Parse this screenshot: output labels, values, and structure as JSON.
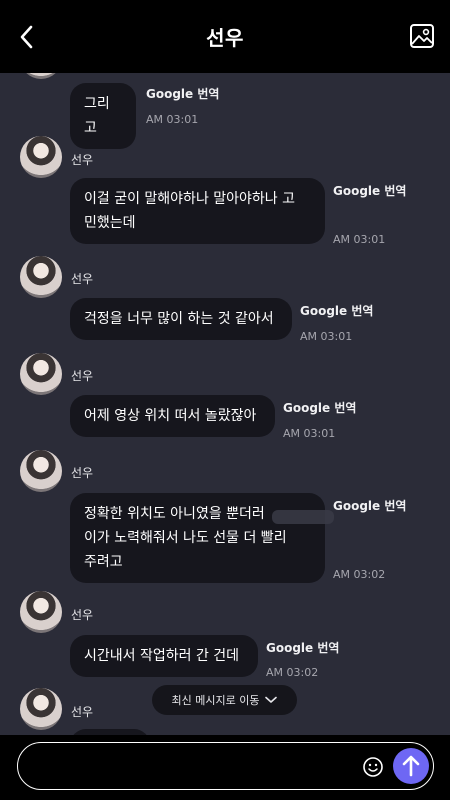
{
  "header": {
    "title": "선우"
  },
  "messages": [
    {
      "sender": "",
      "text": "그리고",
      "translate": "Google 번역",
      "time": "AM 03:01"
    },
    {
      "sender": "선우",
      "text": "이걸 굳이 말해야하나 말아야하나 고\n민했는데",
      "translate": "Google 번역",
      "time": "AM 03:01"
    },
    {
      "sender": "선우",
      "text": "걱정을 너무 많이 하는 것 같아서",
      "translate": "Google 번역",
      "time": "AM 03:01"
    },
    {
      "sender": "선우",
      "text": "어제 영상 위치 떠서 놀랐잖아",
      "translate": "Google 번역",
      "time": "AM 03:01"
    },
    {
      "sender": "선우",
      "text": "정확한 위치도 아니였을 뿐더러\n이가 노력해줘서 나도 선물 더 빨리\n주려고",
      "translate": "Google 번역",
      "time": "AM 03:02"
    },
    {
      "sender": "선우",
      "text": "시간내서 작업하러 간 건데",
      "translate": "Google 번역",
      "time": "AM 03:02"
    },
    {
      "sender": "선우"
    }
  ],
  "latest_pill": {
    "label": "최신 메시지로 이동"
  },
  "composer": {
    "placeholder": ""
  },
  "colors": {
    "accent": "#6e67f4",
    "bubble": "#16161d",
    "background": "#2b2c38"
  }
}
